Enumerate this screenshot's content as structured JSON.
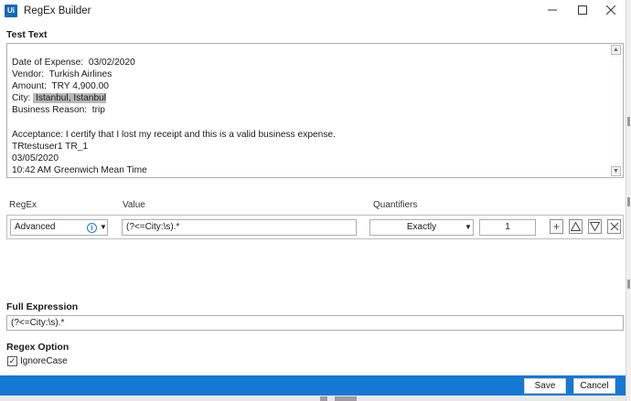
{
  "window": {
    "app_icon": "Ui",
    "title": "RegEx Builder",
    "minimize_icon": "minimize-icon",
    "maximize_icon": "maximize-icon",
    "close_icon": "close-icon"
  },
  "test_text": {
    "label": "Test Text",
    "lines": [
      {
        "before": "Date of Expense:  03/02/2020",
        "highlight": "",
        "after": ""
      },
      {
        "before": "Vendor:  Turkish Airlines",
        "highlight": "",
        "after": ""
      },
      {
        "before": "Amount:  TRY 4,900.00",
        "highlight": "",
        "after": ""
      },
      {
        "before": "City: ",
        "highlight": " Istanbul, Istanbul",
        "after": ""
      },
      {
        "before": "Business Reason:  trip",
        "highlight": "",
        "after": ""
      },
      {
        "before": "",
        "highlight": "",
        "after": ""
      },
      {
        "before": "Acceptance: I certify that I lost my receipt and this is a valid business expense.",
        "highlight": "",
        "after": ""
      },
      {
        "before": "TRtestuser1 TR_1",
        "highlight": "",
        "after": ""
      },
      {
        "before": "03/05/2020",
        "highlight": "",
        "after": ""
      },
      {
        "before": "10:42 AM Greenwich Mean Time",
        "highlight": "",
        "after": ""
      }
    ]
  },
  "regex_table": {
    "headers": {
      "regex": "RegEx",
      "value": "Value",
      "quantifiers": "Quantifiers"
    },
    "row": {
      "regex_type": "Advanced",
      "info_icon": "info-icon",
      "value": "(?<=City:\\s).*",
      "quantifier": "Exactly",
      "count": "1",
      "actions": [
        "add-icon",
        "move-up-icon",
        "move-down-icon",
        "remove-icon"
      ]
    }
  },
  "full_expression": {
    "label": "Full Expression",
    "value": "(?<=City:\\s).*"
  },
  "regex_option": {
    "label": "Regex Option",
    "ignore_case_label": "IgnoreCase",
    "ignore_case_checked": true
  },
  "footer": {
    "save_label": "Save",
    "cancel_label": "Cancel",
    "accent_color": "#1478D4"
  }
}
